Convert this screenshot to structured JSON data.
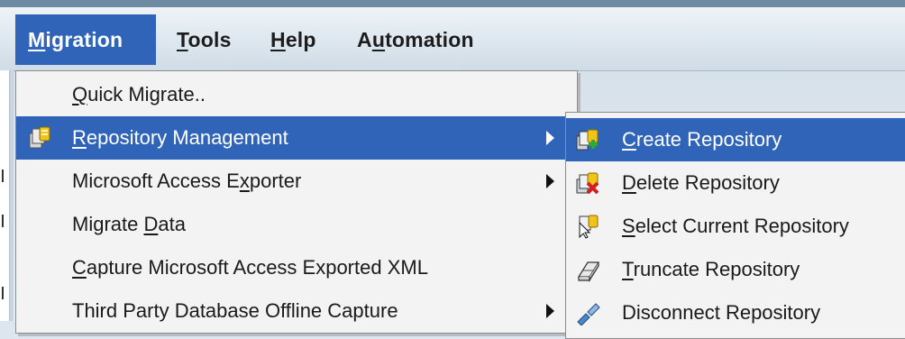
{
  "menubar": {
    "items": [
      {
        "pre": "",
        "mnemonic": "M",
        "post": "igration"
      },
      {
        "pre": "",
        "mnemonic": "T",
        "post": "ools"
      },
      {
        "pre": "",
        "mnemonic": "H",
        "post": "elp"
      },
      {
        "pre": "A",
        "mnemonic": "u",
        "post": "tomation"
      }
    ]
  },
  "migration_menu": {
    "items": [
      {
        "pre": "",
        "mnemonic": "Q",
        "post": "uick Migrate.."
      },
      {
        "pre": "",
        "mnemonic": "R",
        "post": "epository Management"
      },
      {
        "pre": "Microsoft Access E",
        "mnemonic": "x",
        "post": "porter"
      },
      {
        "pre": "Migrate ",
        "mnemonic": "D",
        "post": "ata"
      },
      {
        "pre": "",
        "mnemonic": "C",
        "post": "apture Microsoft Access Exported XML"
      },
      {
        "pre": "Third Party Database Offline Capture",
        "mnemonic": "",
        "post": ""
      }
    ]
  },
  "repository_submenu": {
    "items": [
      {
        "pre": "",
        "mnemonic": "C",
        "post": "reate Repository",
        "icon": "create-repository-icon"
      },
      {
        "pre": "",
        "mnemonic": "D",
        "post": "elete Repository",
        "icon": "delete-repository-icon"
      },
      {
        "pre": "",
        "mnemonic": "S",
        "post": "elect Current Repository",
        "icon": "select-repository-icon"
      },
      {
        "pre": "",
        "mnemonic": "T",
        "post": "runcate Repository",
        "icon": "truncate-repository-icon"
      },
      {
        "pre": "Disconnect Repository",
        "mnemonic": "",
        "post": "",
        "icon": "disconnect-repository-icon"
      }
    ]
  },
  "colors": {
    "highlight": "#2f64b9",
    "menu_bg": "#f3f3f3",
    "menubar_bg": "#dce6ee"
  }
}
